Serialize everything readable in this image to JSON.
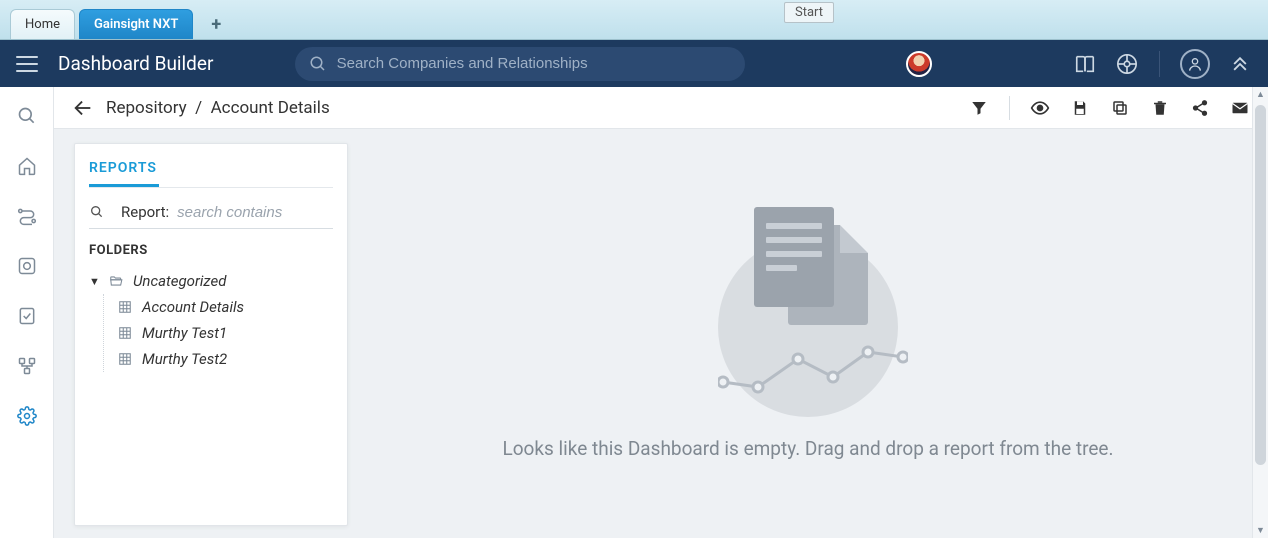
{
  "browser_tabs": {
    "home": "Home",
    "active": "Gainsight NXT",
    "start_tag": "Start"
  },
  "header": {
    "title": "Dashboard Builder",
    "search_placeholder": "Search Companies and Relationships"
  },
  "breadcrumb": {
    "root": "Repository",
    "separator": "/",
    "current": "Account Details"
  },
  "reports_panel": {
    "tab_label": "REPORTS",
    "search_label": "Report:",
    "search_placeholder": "search contains",
    "folders_heading": "FOLDERS",
    "folder": {
      "name": "Uncategorized",
      "items": [
        "Account Details",
        "Murthy Test1",
        "Murthy Test2"
      ]
    }
  },
  "empty_state": {
    "message": "Looks like this Dashboard is empty. Drag and drop a report from the tree."
  }
}
